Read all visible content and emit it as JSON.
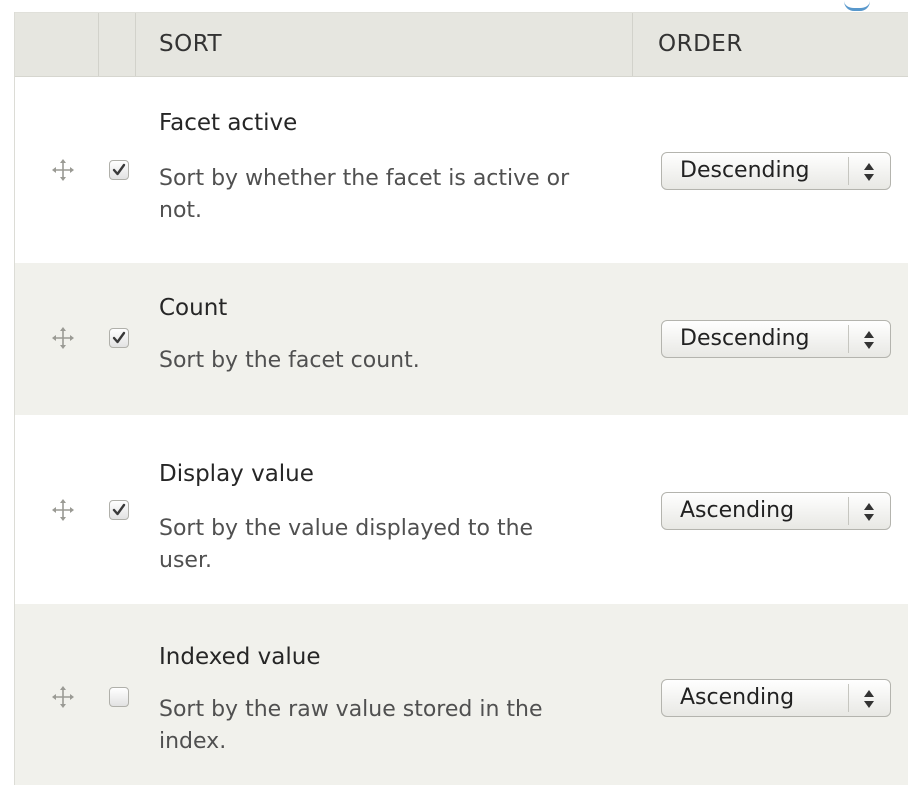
{
  "table": {
    "headers": {
      "sort": "SORT",
      "order": "ORDER"
    },
    "rows": [
      {
        "title": "Facet active",
        "description": "Sort by whether the facet is active or not.",
        "checked": true,
        "order": "Descending"
      },
      {
        "title": "Count",
        "description": "Sort by the facet count.",
        "checked": true,
        "order": "Descending"
      },
      {
        "title": "Display value",
        "description": "Sort by the value displayed to the user.",
        "checked": true,
        "order": "Ascending"
      },
      {
        "title": "Indexed value",
        "description": "Sort by the raw value stored in the index.",
        "checked": false,
        "order": "Ascending"
      }
    ]
  },
  "icons": {
    "drag": "drag-handle-icon",
    "check": "checkmark-icon",
    "select_arrows": "up-down-arrows-icon"
  },
  "colors": {
    "header_bg": "#e6e6e0",
    "row_alt_bg": "#f1f1ec",
    "row_bg": "#ffffff",
    "text": "#262626",
    "desc_text": "#505050",
    "link_accent": "#2f7fc0"
  }
}
